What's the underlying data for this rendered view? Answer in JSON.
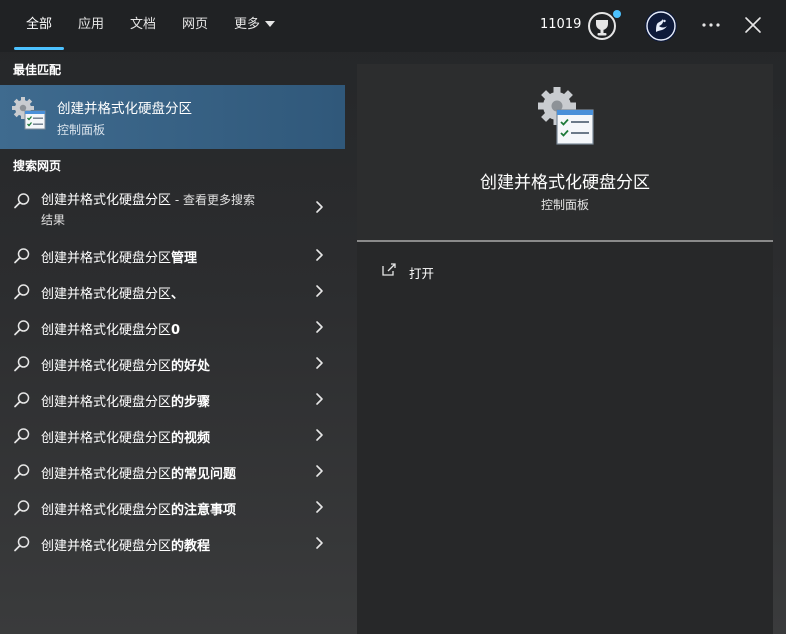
{
  "tabs": [
    {
      "label": "全部",
      "active": true
    },
    {
      "label": "应用",
      "active": false
    },
    {
      "label": "文档",
      "active": false
    },
    {
      "label": "网页",
      "active": false
    },
    {
      "label": "更多",
      "active": false
    }
  ],
  "header": {
    "points": "11019",
    "reward_icon": "rewards-trophy-icon",
    "avatar_icon": "profile-avatar-icon",
    "more_icon": "ellipsis-icon",
    "close_icon": "close-icon"
  },
  "best_match": {
    "section_label": "最佳匹配",
    "title": "创建并格式化硬盘分区",
    "subtitle": "控制面板",
    "icon": "control-panel-settings-icon"
  },
  "web": {
    "section_label": "搜索网页",
    "first": {
      "query": "创建并格式化硬盘分区",
      "suffix": " - 查看更多搜索",
      "suffix_line2": "结果"
    },
    "suggestions": [
      {
        "prefix": "创建并格式化硬盘分区",
        "bold": "管理"
      },
      {
        "prefix": "创建并格式化硬盘分区",
        "bold": "、"
      },
      {
        "prefix": "创建并格式化硬盘分区",
        "bold": "0"
      },
      {
        "prefix": "创建并格式化硬盘分区",
        "bold": "的好处"
      },
      {
        "prefix": "创建并格式化硬盘分区",
        "bold": "的步骤"
      },
      {
        "prefix": "创建并格式化硬盘分区",
        "bold": "的视频"
      },
      {
        "prefix": "创建并格式化硬盘分区",
        "bold": "的常见问题"
      },
      {
        "prefix": "创建并格式化硬盘分区",
        "bold": "的注意事项"
      },
      {
        "prefix": "创建并格式化硬盘分区",
        "bold": "的教程"
      }
    ]
  },
  "preview": {
    "title": "创建并格式化硬盘分区",
    "subtitle": "控制面板",
    "actions": [
      {
        "label": "打开",
        "icon": "open-external-icon"
      }
    ]
  },
  "colors": {
    "accent": "#4cc2ff",
    "selected_row": "#3f6b8f",
    "topbar": "#202224"
  }
}
